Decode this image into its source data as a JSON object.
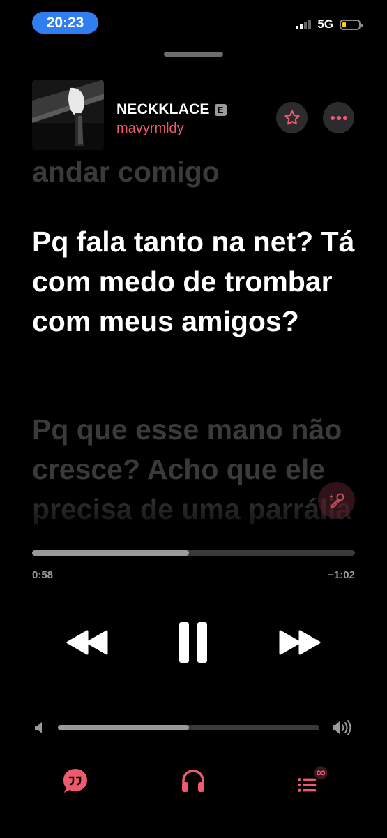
{
  "status_bar": {
    "time": "20:23",
    "network": "5G",
    "battery_level": 0.15
  },
  "now_playing": {
    "title": "NECKKLACE",
    "explicit_badge": "E",
    "artist": "mavyrmldy",
    "artwork_icon": "album-art"
  },
  "lyrics": {
    "previous": "andar comigo",
    "current": "Pq fala tanto na net? Tá com medo de trombar com meus amigos?",
    "next": "Pq que esse mano não cresce? Acho que ele precisa de uma parrália"
  },
  "playback": {
    "elapsed": "0:58",
    "remaining": "−1:02",
    "progress_fraction": 0.486
  },
  "volume": {
    "level_fraction": 0.5
  },
  "icons": {
    "favorite": "star-icon",
    "more": "ellipsis-icon",
    "sing": "microphone-sparkle-icon",
    "rewind": "rewind-icon",
    "pause": "pause-icon",
    "forward": "forward-icon",
    "lyrics": "lyrics-quote-icon",
    "airplay": "headphones-icon",
    "queue": "queue-infinity-icon"
  },
  "colors": {
    "accent": "#f05a6e",
    "status_pill": "#2f7ff0",
    "background": "#000000",
    "dim_lyric": "#3a3a3a"
  }
}
